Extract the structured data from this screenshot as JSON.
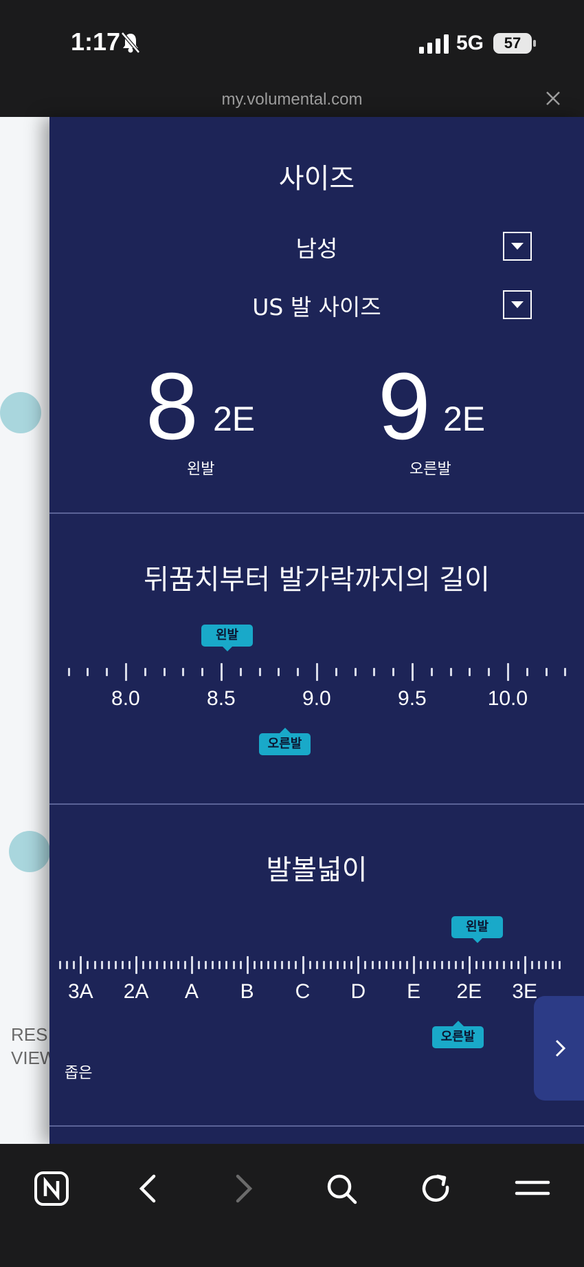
{
  "status_bar": {
    "time": "1:17",
    "network": "5G",
    "battery": "57"
  },
  "browser": {
    "url": "my.volumental.com"
  },
  "background_page": {
    "text_line1": "RES",
    "text_line2": "VIEW"
  },
  "size_section": {
    "title": "사이즈",
    "gender_select": "남성",
    "unit_select": "US 발 사이즈",
    "left_foot": {
      "size": "8",
      "width": "2E",
      "caption": "왼발"
    },
    "right_foot": {
      "size": "9",
      "width": "2E",
      "caption": "오른발"
    }
  },
  "length_section": {
    "title": "뒤꿈치부터 발가락까지의 길이",
    "scale_labels": [
      "8.0",
      "8.5",
      "9.0",
      "9.5",
      "10.0"
    ],
    "left_marker": {
      "label": "왼발",
      "value": 8.5
    },
    "right_marker": {
      "label": "오른발",
      "value": 8.85
    }
  },
  "width_section": {
    "title": "발볼넓이",
    "scale_labels": [
      "3A",
      "2A",
      "A",
      "B",
      "C",
      "D",
      "E",
      "2E",
      "3E"
    ],
    "left_marker": {
      "label": "왼발",
      "value": "2E"
    },
    "right_marker": {
      "label": "오른발",
      "value": "between E and 2E"
    },
    "narrow_caption": "좁은"
  },
  "icons": {
    "bell": "bell-slash-icon",
    "signal": "signal-icon",
    "close": "close-icon",
    "next": "chevron-right-icon",
    "toolbar": [
      "naver-home-icon",
      "back-arrow-icon",
      "forward-arrow-icon",
      "search-icon",
      "reload-icon",
      "menu-icon"
    ]
  },
  "colors": {
    "panel": "#1d2457",
    "marker": "#19a9c9",
    "next_button": "#2c3b86",
    "chrome": "#1b1b1c"
  }
}
